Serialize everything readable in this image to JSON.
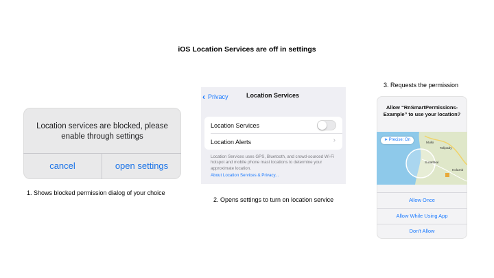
{
  "slide": {
    "title": "iOS Location Services are off in settings"
  },
  "panel1": {
    "message": "Location services are blocked, please enable through settings",
    "cancel_label": "cancel",
    "open_settings_label": "open settings",
    "caption": "1. Shows blocked permission dialog of your choice"
  },
  "panel2": {
    "back_label": "Privacy",
    "nav_title": "Location Services",
    "rows": [
      {
        "label": "Location Services",
        "toggle_on": false
      },
      {
        "label": "Location Alerts"
      }
    ],
    "footnote": "Location Services uses GPS, Bluetooth, and crowd-sourced Wi-Fi hotspot and mobile phone mast locations to determine your approximate location.",
    "footnote_link": "About Location Services & Privacy...",
    "caption": "2. Opens settings to turn on location service"
  },
  "panel3": {
    "caption": "3. Requests the permission",
    "title": "Allow “RnSmartPermissions-Example” to use your location?",
    "precise_label": "Precise: On",
    "map_labels": [
      "Mulki",
      "Talipady",
      "Surathkal",
      "Kolamb"
    ],
    "buttons": [
      "Allow Once",
      "Allow While Using App",
      "Don't Allow"
    ]
  },
  "colors": {
    "ios_blue": "#1a7aff",
    "dialog_blue": "#1a73e8",
    "map_sea": "#8ec9ea",
    "map_land": "#dfe7c9"
  }
}
